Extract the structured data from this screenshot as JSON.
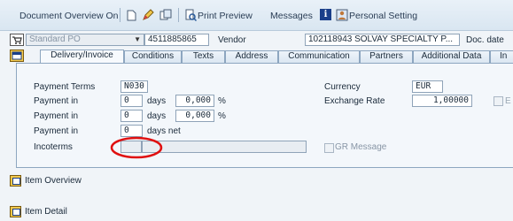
{
  "toolbar": {
    "document_overview": "Document Overview On",
    "print_preview": "Print Preview",
    "messages": "Messages",
    "personal_setting": "Personal Setting"
  },
  "header": {
    "doc_type": "Standard PO",
    "po_number": "4511885865",
    "vendor_label": "Vendor",
    "vendor_value": "102118943 SOLVAY SPECIALTY P...",
    "doc_date_label": "Doc. date"
  },
  "tabs": [
    "Delivery/Invoice",
    "Conditions",
    "Texts",
    "Address",
    "Communication",
    "Partners",
    "Additional Data",
    "In"
  ],
  "delivery": {
    "payment_terms_label": "Payment Terms",
    "payment_terms_value": "N030",
    "payment_in_label": "Payment in",
    "rows": [
      {
        "days": "0",
        "days_unit": "days",
        "pct": "0,000",
        "pct_unit": "%"
      },
      {
        "days": "0",
        "days_unit": "days",
        "pct": "0,000",
        "pct_unit": "%"
      },
      {
        "days": "0",
        "days_unit": "days net"
      }
    ],
    "incoterms_label": "Incoterms",
    "incoterms_value": "",
    "incoterms_desc": "",
    "currency_label": "Currency",
    "currency_value": "EUR",
    "exchange_rate_label": "Exchange Rate",
    "exchange_rate_value": "1,00000",
    "gr_message_label": "GR Message"
  },
  "bottom": {
    "item_overview": "Item Overview",
    "item_detail": "Item Detail"
  },
  "colors": {
    "annotation": "#e01010"
  }
}
